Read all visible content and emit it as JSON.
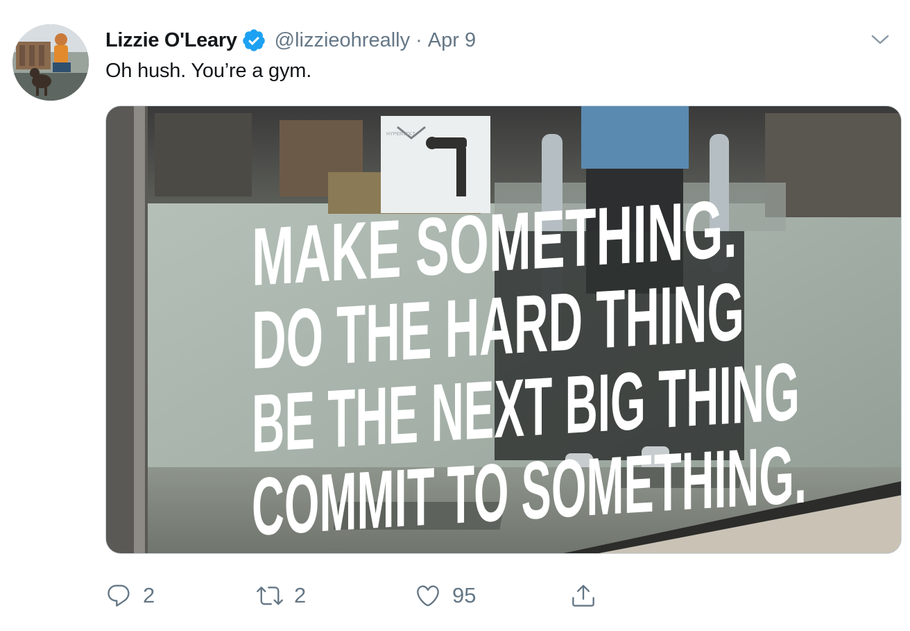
{
  "tweet": {
    "author": {
      "display_name": "Lizzie O'Leary",
      "handle": "@lizzieohreally",
      "verified": true,
      "avatar_icon": "avatar-photo"
    },
    "separator": "·",
    "date": "Apr 9",
    "text": "Oh hush. You’re a gym.",
    "menu_icon": "chevron-down-icon",
    "media": {
      "sign_lines": [
        "MAKE SOMETHING.",
        "DO THE HARD THING",
        "BE THE NEXT BIG THING",
        "COMMIT TO SOMETHING."
      ],
      "box_brand": "HYPERVOLT"
    },
    "actions": {
      "reply_count": "2",
      "retweet_count": "2",
      "like_count": "95"
    }
  },
  "colors": {
    "text_primary": "#14171a",
    "text_secondary": "#657786",
    "verified_blue": "#1da1f2",
    "border": "#ccd6dd"
  }
}
